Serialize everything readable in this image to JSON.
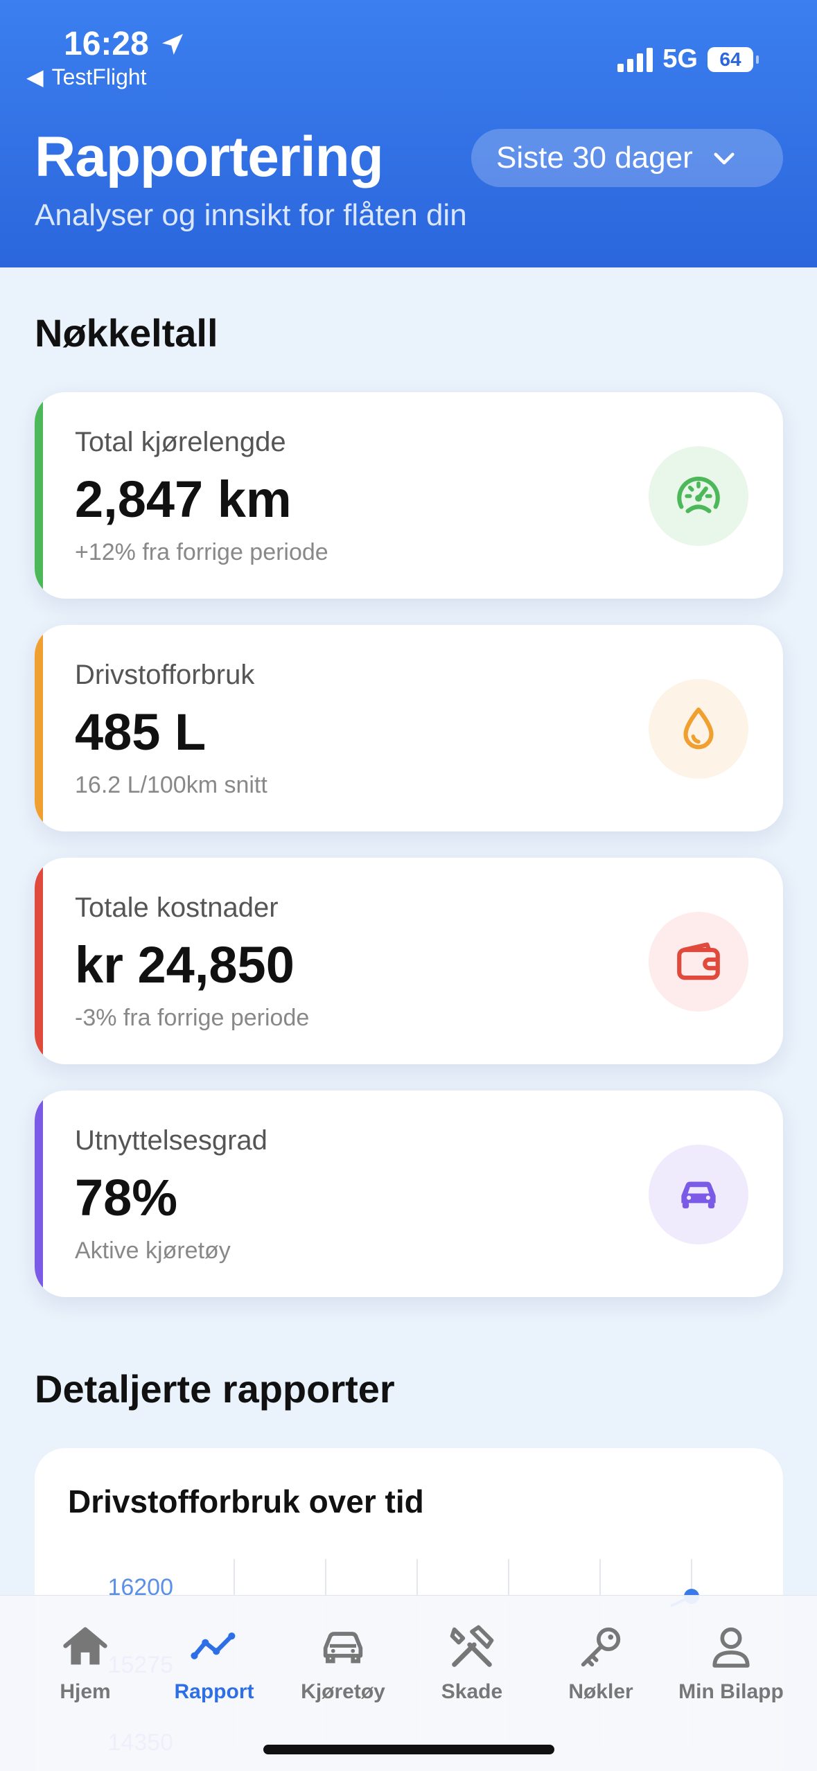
{
  "status_bar": {
    "time": "16:28",
    "back_app": "TestFlight",
    "network": "5G",
    "battery": "64"
  },
  "header": {
    "title": "Rapportering",
    "subtitle": "Analyser og innsikt for flåten din",
    "period": "Siste 30 dager"
  },
  "key_figures": {
    "title": "Nøkkeltall",
    "cards": [
      {
        "label": "Total kjørelengde",
        "value": "2,847 km",
        "note": "+12% fra forrige periode",
        "icon": "speedometer-icon",
        "color": "#4cb85a"
      },
      {
        "label": "Drivstofforbruk",
        "value": "485 L",
        "note": "16.2 L/100km snitt",
        "icon": "fuel-drop-icon",
        "color": "#f0a030"
      },
      {
        "label": "Totale kostnader",
        "value": "kr 24,850",
        "note": "-3% fra forrige periode",
        "icon": "wallet-icon",
        "color": "#e04a3c"
      },
      {
        "label": "Utnyttelsesgrad",
        "value": "78%",
        "note": "Aktive kjøretøy",
        "icon": "car-icon",
        "color": "#7b5ae8"
      }
    ]
  },
  "detailed_reports": {
    "title": "Detaljerte rapporter",
    "chart_title": "Drivstofforbruk over tid"
  },
  "chart_data": {
    "type": "line",
    "title": "Drivstofforbruk over tid",
    "y_ticks": [
      "16200",
      "15275",
      "14350"
    ],
    "ylim": [
      14350,
      16200
    ],
    "visible_points": [
      {
        "x_index": 5,
        "y": 16200
      }
    ],
    "grid": true
  },
  "tabbar": {
    "tabs": [
      {
        "label": "Hjem",
        "icon": "home-icon",
        "active": false
      },
      {
        "label": "Rapport",
        "icon": "chart-line-icon",
        "active": true
      },
      {
        "label": "Kjøretøy",
        "icon": "car-icon",
        "active": false
      },
      {
        "label": "Skade",
        "icon": "tools-icon",
        "active": false
      },
      {
        "label": "Nøkler",
        "icon": "key-icon",
        "active": false
      },
      {
        "label": "Min Bilapp",
        "icon": "person-icon",
        "active": false
      }
    ]
  }
}
